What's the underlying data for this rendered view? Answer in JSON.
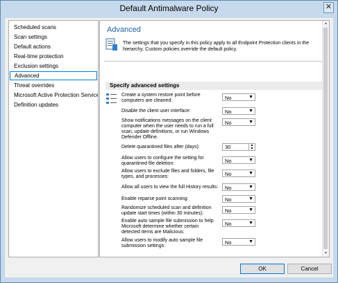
{
  "window": {
    "title": "Default Antimalware Policy",
    "close_glyph": "✕"
  },
  "sidebar": {
    "items": [
      {
        "label": "Scheduled scans"
      },
      {
        "label": "Scan settings"
      },
      {
        "label": "Default actions"
      },
      {
        "label": "Real-time protection"
      },
      {
        "label": "Exclusion settings"
      },
      {
        "label": "Advanced"
      },
      {
        "label": "Threat overrides"
      },
      {
        "label": "Microsoft Active Protection Service"
      },
      {
        "label": "Definition updates"
      }
    ],
    "selected": "Advanced"
  },
  "main": {
    "heading": "Advanced",
    "description": "The settings that you specify in this policy apply to all Endpoint Protection clients in the hierarchy. Custom policies override the default policy.",
    "section_title": "Specify advanced settings",
    "settings": [
      {
        "label": "Create a system restore point before computers are cleaned:",
        "value": "No"
      },
      {
        "label": "Disable the client user interface:",
        "value": "No"
      },
      {
        "label": "Show notifications messages on the client computer when the user needs to run a full scan, update definitions, or run Windows Defender Offline.",
        "value": "No"
      },
      {
        "label": "Delete quarantined files after (days):",
        "value": "30"
      },
      {
        "label": "Allow users to configure the setting for quarantined file deletion:",
        "value": "No"
      },
      {
        "label": "Allow users to exclude files and folders, file types, and processes:",
        "value": "No"
      },
      {
        "label": "Allow all users to view the full History results:",
        "value": "No"
      },
      {
        "label": "Enable reparse point scanning:",
        "value": "No"
      },
      {
        "label": "Randomize scheduled scan and definition update start times (within 30 minutes):",
        "value": "No"
      },
      {
        "label": "Enable auto sample file submission to help Microsoft determine whether certain detected items are Malicious:",
        "value": "No"
      },
      {
        "label": "Allow users to modify auto sample file submission settings:",
        "value": "No"
      }
    ]
  },
  "buttons": {
    "ok": "OK",
    "cancel": "Cancel"
  },
  "icons": {
    "dropdown": "chevron-down-icon",
    "spin": "spin-arrows-icon"
  },
  "colors": {
    "accent": "#1e5fa8",
    "titlebar": "#c7d9ec",
    "selection_border": "#0078d7"
  }
}
